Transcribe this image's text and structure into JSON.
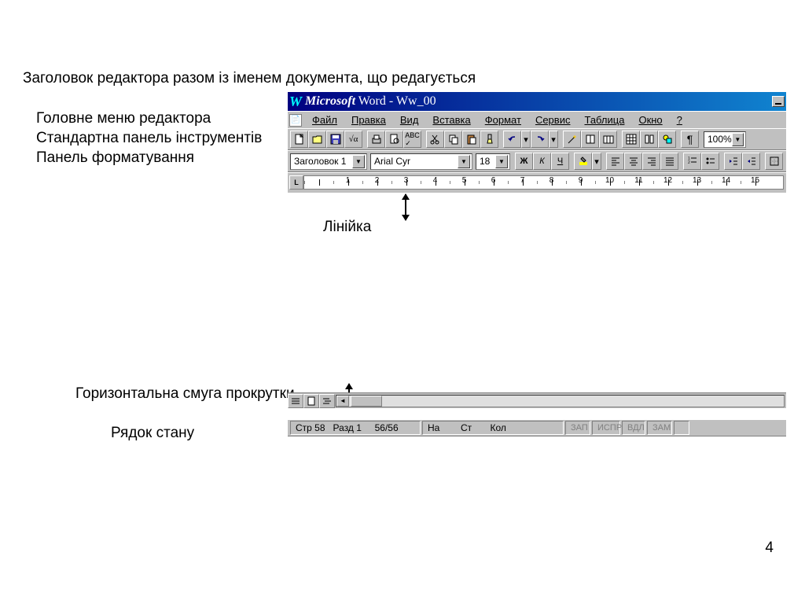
{
  "labels": {
    "title_desc": "Заголовок редактора разом із іменем документа, що редагується",
    "menu_desc": "Головне меню редактора",
    "std_desc": "Стандартна панель інструментів",
    "fmt_desc": "Панель форматування",
    "ruler_desc": "Лінійка",
    "scroll_desc": "Горизонтальна смуга прокрутки",
    "status_desc": "Рядок стану"
  },
  "title": {
    "app_prefix": "Microsoft",
    "app_suffix": " Word - ",
    "doc": "Ww_00",
    "w": "W"
  },
  "menu": {
    "items": [
      "Файл",
      "Правка",
      "Вид",
      "Вставка",
      "Формат",
      "Сервис",
      "Таблица",
      "Окно",
      "?"
    ]
  },
  "fmt": {
    "style": "Заголовок 1",
    "font": "Arial Cyr",
    "size": "18"
  },
  "zoom": "100%",
  "ruler": {
    "nums": [
      "",
      "1",
      "2",
      "3",
      "4",
      "5",
      "6",
      "7",
      "8",
      "9",
      "10",
      "11",
      "12",
      "13",
      "14",
      "15"
    ]
  },
  "status": {
    "page": "Стр 58",
    "section": "Разд 1",
    "pages": "56/56",
    "at": "На",
    "ln": "Ст",
    "col": "Кол",
    "rec": "ЗАП",
    "trk": "ИСПР",
    "ext": "ВДЛ",
    "ovr": "ЗАМ"
  },
  "pagenum": "4"
}
